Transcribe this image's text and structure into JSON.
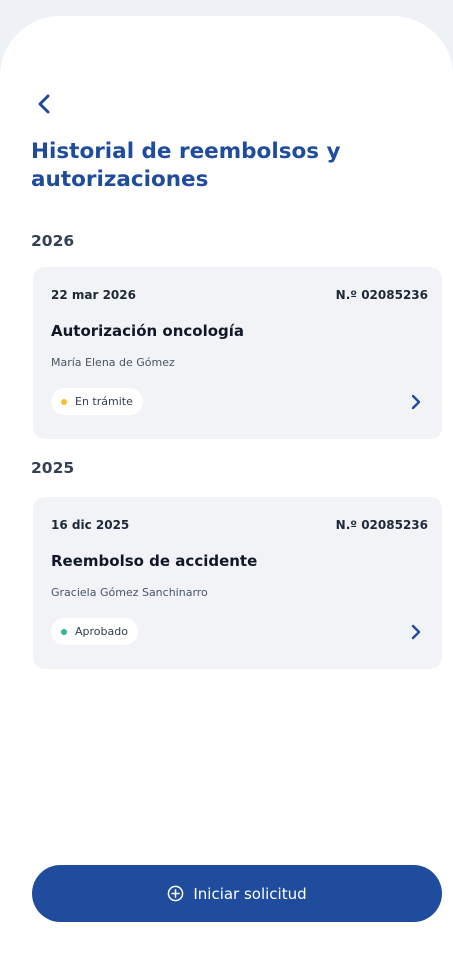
{
  "header": {
    "title": "Historial de reembolsos y autorizaciones"
  },
  "groups": [
    {
      "year": "2026",
      "card": {
        "date": "22 mar 2026",
        "number": "N.º 02085236",
        "title": "Autorización oncología",
        "person": "María Elena de Gómez",
        "status": "En trámite",
        "status_color": "#f5c02f"
      }
    },
    {
      "year": "2025",
      "card": {
        "date": "16 dic 2025",
        "number": "N.º 02085236",
        "title": "Reembolso de accidente",
        "person": "Graciela Gómez Sanchinarro",
        "status": "Aprobado",
        "status_color": "#2fb58f"
      }
    }
  ],
  "cta": {
    "label": "Iniciar solicitud",
    "icon": "plus-circle-icon"
  },
  "colors": {
    "primary": "#1f4c9d",
    "card_bg": "#f2f3f6"
  }
}
